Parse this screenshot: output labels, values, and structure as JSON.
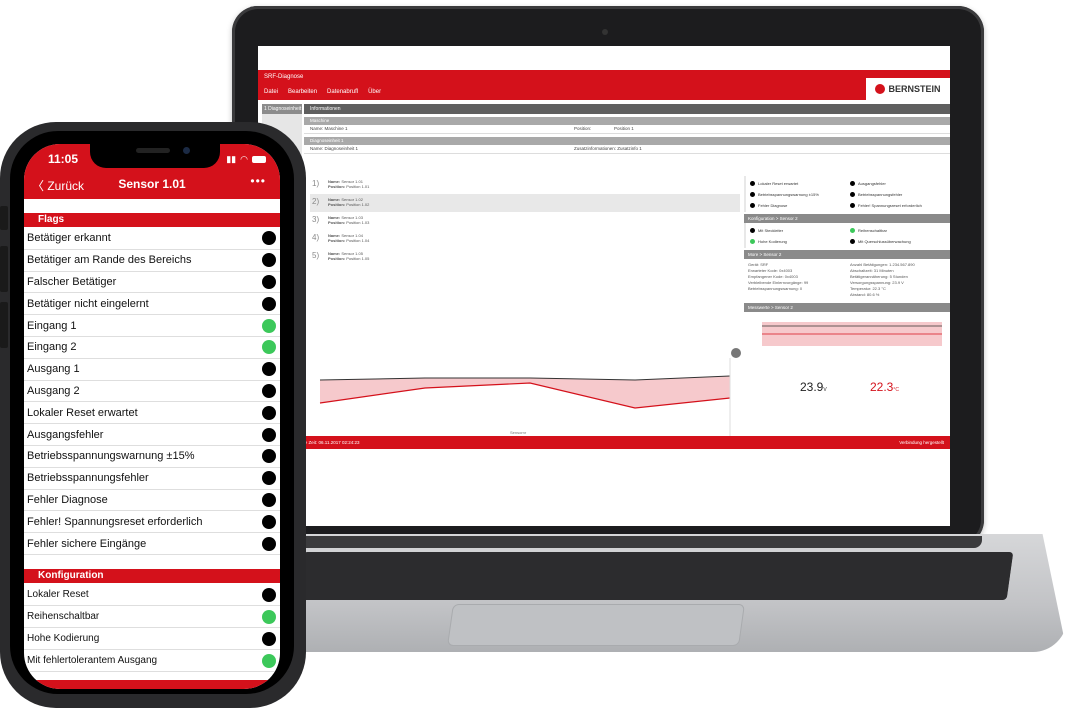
{
  "colors": {
    "brand_red": "#d4111b",
    "indicator_green": "#3cc85a",
    "indicator_black": "#000000"
  },
  "laptop": {
    "window_title": "SRF-Diagnose",
    "menu": [
      "Datei",
      "Bearbeiten",
      "Datenabrufl",
      "Über"
    ],
    "brand_name": "BERNSTEIN",
    "side_tab": "1 Diagnoseinheit 1",
    "info_header": "Informationen",
    "maschine_label": "Maschine",
    "maschine_row": {
      "name": "Name: Maschine 1",
      "position_label": "Position:",
      "position_value": "Position 1"
    },
    "diagnoseinheit_label": "Diagnoseinheit 1",
    "diagnoseinheit_row": {
      "name": "Name: Diagnoseinheit 1",
      "zusatz": "Zusatzinformationen: Zusatzinfo 1"
    },
    "sensors": [
      {
        "num": "1)",
        "name": "Sensor 1.01",
        "position": "Position 1.01"
      },
      {
        "num": "2)",
        "name": "Sensor 1.02",
        "position": "Position 1.02"
      },
      {
        "num": "3)",
        "name": "Sensor 1.03",
        "position": "Position 1.03"
      },
      {
        "num": "4)",
        "name": "Sensor 1.04",
        "position": "Position 1.04"
      },
      {
        "num": "5)",
        "name": "Sensor 1.05",
        "position": "Position 1.05"
      }
    ],
    "sensor_name_label": "Name:",
    "sensor_position_label": "Position:",
    "right_flags": [
      {
        "label": "Lokaler Reset erwartet",
        "state": "black"
      },
      {
        "label": "Ausgangsfehler",
        "state": "black"
      },
      {
        "label": "Betriebsspannungswarnung ±15%",
        "state": "black"
      },
      {
        "label": "Betriebsspannungsfehler",
        "state": "black"
      },
      {
        "label": "Fehler Diagnose",
        "state": "black"
      },
      {
        "label": "Fehler! Spannungsreset erforderlich",
        "state": "black"
      }
    ],
    "konfig_header": "Konfiguration > Sensor 2",
    "konfig_flags": [
      {
        "label": "Mit Steckleiter",
        "state": "black"
      },
      {
        "label": "Reihenschaltbar",
        "state": "green"
      },
      {
        "label": "Hohe Kodierung",
        "state": "green"
      },
      {
        "label": "Mit Querschlussüberwachung",
        "state": "black"
      }
    ],
    "more_header": "More > Sensor 2",
    "more_info": [
      "Gerät: SRF",
      "Anzahl Betätigungen: 1.234.567.890",
      "Erwarteter Kode: 0x4003",
      "Abschaltzeit: 31 Minuten",
      "Empfangener Kode: 0x4003",
      "Betätigerannäherung: 5 Stunden",
      "Verbleibende Einlernvorgänge: 99",
      "Versorgungsspannung: 23.9 V",
      "Betriebsspannungswarnung: 0",
      "Temperatur: 22.3 °C",
      "",
      "Abstand: 80.6 %"
    ],
    "messwerte_header": "Messwerte > Sensor 2",
    "gauge_voltage": "23.9",
    "gauge_voltage_unit": "V",
    "gauge_temp": "22.3",
    "gauge_temp_unit": "°C",
    "chart_x_label": "Sensornr",
    "status_left": "0001 00:00:14   Lokale Zeit: 06.11.2017 02:24:23",
    "status_right": "Verbindung hergestellt"
  },
  "phone": {
    "time": "11:05",
    "back_label": "Zurück",
    "title": "Sensor 1.01",
    "more": "•••",
    "flags_header": "Flags",
    "flags": [
      {
        "label": "Betätiger erkannt",
        "state": "black"
      },
      {
        "label": "Betätiger am Rande des Bereichs",
        "state": "black"
      },
      {
        "label": "Falscher Betätiger",
        "state": "black"
      },
      {
        "label": "Betätiger nicht eingelernt",
        "state": "black"
      },
      {
        "label": "Eingang 1",
        "state": "green"
      },
      {
        "label": "Eingang 2",
        "state": "green"
      },
      {
        "label": "Ausgang 1",
        "state": "black"
      },
      {
        "label": "Ausgang 2",
        "state": "black"
      },
      {
        "label": "Lokaler Reset erwartet",
        "state": "black"
      },
      {
        "label": "Ausgangsfehler",
        "state": "black"
      },
      {
        "label": "Betriebsspannungswarnung ±15%",
        "state": "black"
      },
      {
        "label": "Betriebsspannungsfehler",
        "state": "black"
      },
      {
        "label": "Fehler Diagnose",
        "state": "black"
      },
      {
        "label": "Fehler! Spannungsreset erforderlich",
        "state": "black"
      },
      {
        "label": "Fehler sichere Eingänge",
        "state": "black"
      }
    ],
    "konfig_header": "Konfiguration",
    "konfig": [
      {
        "label": "Lokaler Reset",
        "state": "black"
      },
      {
        "label": "Reihenschaltbar",
        "state": "green"
      },
      {
        "label": "Hohe Kodierung",
        "state": "black"
      },
      {
        "label": "Mit fehlertolerantem Ausgang",
        "state": "green"
      }
    ]
  }
}
